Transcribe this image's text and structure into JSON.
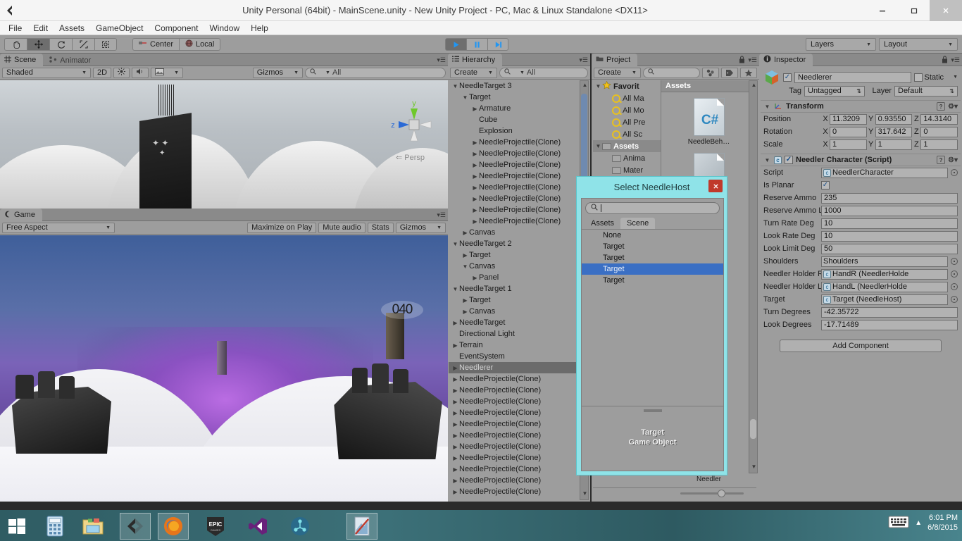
{
  "window": {
    "title": "Unity Personal (64bit) - MainScene.unity - New Unity Project - PC, Mac & Linux Standalone <DX11>",
    "minimize": "—",
    "maximize": "❐",
    "close": "✕"
  },
  "menu": [
    "File",
    "Edit",
    "Assets",
    "GameObject",
    "Component",
    "Window",
    "Help"
  ],
  "toolbar": {
    "tools": [
      "hand-tool",
      "move-tool",
      "rotate-tool",
      "scale-tool",
      "rect-tool"
    ],
    "active_tool_index": 1,
    "pivot_label": "Center",
    "space_label": "Local",
    "play_label": "▶",
    "pause_label": "❙❙",
    "step_label": "▶❙",
    "layers_label": "Layers",
    "layout_label": "Layout"
  },
  "scene_panel": {
    "tabs": [
      {
        "label": "Scene",
        "icon": "grid-icon",
        "active": true
      },
      {
        "label": "Animator",
        "icon": "animator-icon",
        "active": false
      }
    ],
    "draw_mode": "Shaded",
    "mode_2d": "2D",
    "gizmos_label": "Gizmos",
    "search_placeholder": "All",
    "persp_label": "Persp",
    "axis_y": "y",
    "axis_z": "z"
  },
  "game_panel": {
    "tabs": [
      {
        "label": "Game",
        "icon": "game-icon",
        "active": true
      }
    ],
    "aspect": "Free Aspect",
    "maximize_on_play": "Maximize on Play",
    "mute_audio": "Mute audio",
    "stats": "Stats",
    "gizmos": "Gizmos",
    "hud_counter": "040"
  },
  "hierarchy": {
    "tab_label": "Hierarchy",
    "create_label": "Create",
    "search_placeholder": "All",
    "items": [
      {
        "label": "NeedleTarget 3",
        "depth": 0,
        "arrow": "down"
      },
      {
        "label": "Target",
        "depth": 1,
        "arrow": "down"
      },
      {
        "label": "Armature",
        "depth": 2,
        "arrow": "right"
      },
      {
        "label": "Cube",
        "depth": 2,
        "arrow": "none"
      },
      {
        "label": "Explosion",
        "depth": 2,
        "arrow": "none"
      },
      {
        "label": "NeedleProjectile(Clone)",
        "depth": 2,
        "arrow": "right"
      },
      {
        "label": "NeedleProjectile(Clone)",
        "depth": 2,
        "arrow": "right"
      },
      {
        "label": "NeedleProjectile(Clone)",
        "depth": 2,
        "arrow": "right"
      },
      {
        "label": "NeedleProjectile(Clone)",
        "depth": 2,
        "arrow": "right"
      },
      {
        "label": "NeedleProjectile(Clone)",
        "depth": 2,
        "arrow": "right"
      },
      {
        "label": "NeedleProjectile(Clone)",
        "depth": 2,
        "arrow": "right"
      },
      {
        "label": "NeedleProjectile(Clone)",
        "depth": 2,
        "arrow": "right"
      },
      {
        "label": "NeedleProjectile(Clone)",
        "depth": 2,
        "arrow": "right"
      },
      {
        "label": "Canvas",
        "depth": 1,
        "arrow": "right"
      },
      {
        "label": "NeedleTarget 2",
        "depth": 0,
        "arrow": "down"
      },
      {
        "label": "Target",
        "depth": 1,
        "arrow": "right"
      },
      {
        "label": "Canvas",
        "depth": 1,
        "arrow": "down"
      },
      {
        "label": "Panel",
        "depth": 2,
        "arrow": "right"
      },
      {
        "label": "NeedleTarget 1",
        "depth": 0,
        "arrow": "down"
      },
      {
        "label": "Target",
        "depth": 1,
        "arrow": "right"
      },
      {
        "label": "Canvas",
        "depth": 1,
        "arrow": "right"
      },
      {
        "label": "NeedleTarget",
        "depth": 0,
        "arrow": "right"
      },
      {
        "label": "Directional Light",
        "depth": 0,
        "arrow": "none"
      },
      {
        "label": "Terrain",
        "depth": 0,
        "arrow": "right"
      },
      {
        "label": "EventSystem",
        "depth": 0,
        "arrow": "none"
      },
      {
        "label": "Needlerer",
        "depth": 0,
        "arrow": "right",
        "selected": true
      },
      {
        "label": "NeedleProjectile(Clone)",
        "depth": 0,
        "arrow": "right"
      },
      {
        "label": "NeedleProjectile(Clone)",
        "depth": 0,
        "arrow": "right"
      },
      {
        "label": "NeedleProjectile(Clone)",
        "depth": 0,
        "arrow": "right"
      },
      {
        "label": "NeedleProjectile(Clone)",
        "depth": 0,
        "arrow": "right"
      },
      {
        "label": "NeedleProjectile(Clone)",
        "depth": 0,
        "arrow": "right"
      },
      {
        "label": "NeedleProjectile(Clone)",
        "depth": 0,
        "arrow": "right"
      },
      {
        "label": "NeedleProjectile(Clone)",
        "depth": 0,
        "arrow": "right"
      },
      {
        "label": "NeedleProjectile(Clone)",
        "depth": 0,
        "arrow": "right"
      },
      {
        "label": "NeedleProjectile(Clone)",
        "depth": 0,
        "arrow": "right"
      },
      {
        "label": "NeedleProjectile(Clone)",
        "depth": 0,
        "arrow": "right"
      },
      {
        "label": "NeedleProjectile(Clone)",
        "depth": 0,
        "arrow": "right"
      }
    ]
  },
  "project": {
    "tab_label": "Project",
    "create_label": "Create",
    "search_placeholder": "",
    "tree": [
      {
        "label": "Favorit",
        "icon": "star-icon",
        "depth": 0,
        "arrow": "down",
        "bold": true
      },
      {
        "label": "All Ma",
        "icon": "search-icon",
        "depth": 1,
        "arrow": "none"
      },
      {
        "label": "All Mo",
        "icon": "search-icon",
        "depth": 1,
        "arrow": "none"
      },
      {
        "label": "All Pre",
        "icon": "search-icon",
        "depth": 1,
        "arrow": "none"
      },
      {
        "label": "All Sc",
        "icon": "search-icon",
        "depth": 1,
        "arrow": "none"
      },
      {
        "label": "Assets",
        "icon": "folder-icon",
        "depth": 0,
        "arrow": "down",
        "selected": true
      },
      {
        "label": "Anima",
        "icon": "folder-icon",
        "depth": 1,
        "arrow": "none"
      },
      {
        "label": "Mater",
        "icon": "folder-icon",
        "depth": 1,
        "arrow": "none"
      }
    ],
    "content_header": "Assets",
    "assets": [
      {
        "label": "NeedleBeh…",
        "icon": "csharp-script-icon"
      },
      {
        "label": "Needler",
        "icon": "prefab-icon"
      }
    ]
  },
  "inspector": {
    "tab_label": "Inspector",
    "object_name": "Needlerer",
    "enabled": true,
    "static_label": "Static",
    "tag_label": "Tag",
    "tag_value": "Untagged",
    "layer_label": "Layer",
    "layer_value": "Default",
    "transform": {
      "title": "Transform",
      "rows": [
        {
          "label": "Position",
          "x": "11.3209",
          "y": "0.93550",
          "z": "14.3140"
        },
        {
          "label": "Rotation",
          "x": "0",
          "y": "317.642",
          "z": "0"
        },
        {
          "label": "Scale",
          "x": "1",
          "y": "1",
          "z": "1"
        }
      ],
      "axes": [
        "X",
        "Y",
        "Z"
      ]
    },
    "script_component": {
      "title": "Needler Character (Script)",
      "enabled": true,
      "fields": [
        {
          "label": "Script",
          "value": "NeedlerCharacter",
          "type": "object",
          "icon": "script-icon"
        },
        {
          "label": "Is Planar",
          "value": "",
          "type": "checkbox",
          "checked": true
        },
        {
          "label": "Reserve Ammo",
          "value": "235",
          "type": "text"
        },
        {
          "label": "Reserve Ammo Limit",
          "value": "1000",
          "type": "text"
        },
        {
          "label": "Turn Rate Deg",
          "value": "10",
          "type": "text"
        },
        {
          "label": "Look Rate Deg",
          "value": "10",
          "type": "text"
        },
        {
          "label": "Look Limit Deg",
          "value": "50",
          "type": "text"
        },
        {
          "label": "Shoulders",
          "value": "Shoulders",
          "type": "object"
        },
        {
          "label": "Needler Holder R",
          "value": "HandR (NeedlerHolde",
          "type": "object",
          "icon": "script-icon"
        },
        {
          "label": "Needler Holder L",
          "value": "HandL (NeedlerHolde",
          "type": "object",
          "icon": "script-icon"
        },
        {
          "label": "Target",
          "value": "Target (NeedleHost)",
          "type": "object",
          "icon": "script-icon"
        },
        {
          "label": "Turn Degrees",
          "value": "-42.35722",
          "type": "text"
        },
        {
          "label": "Look Degrees",
          "value": "-17.71489",
          "type": "text"
        }
      ]
    },
    "add_component_label": "Add Component"
  },
  "dialog": {
    "title": "Select NeedleHost",
    "close_label": "✕",
    "search_value": "",
    "tabs": [
      {
        "label": "Assets",
        "active": false
      },
      {
        "label": "Scene",
        "active": true
      }
    ],
    "rows": [
      {
        "label": "None",
        "selected": false
      },
      {
        "label": "Target",
        "selected": false
      },
      {
        "label": "Target",
        "selected": false
      },
      {
        "label": "Target",
        "selected": true
      },
      {
        "label": "Target",
        "selected": false
      }
    ],
    "preview_line1": "Target",
    "preview_line2": "Game Object"
  },
  "taskbar": {
    "items": [
      {
        "name": "start-button",
        "icon": "windows-logo"
      },
      {
        "name": "calculator",
        "icon": "calculator-icon"
      },
      {
        "name": "file-explorer",
        "icon": "folder-icon"
      },
      {
        "name": "unity",
        "icon": "unity-icon",
        "active": true
      },
      {
        "name": "firefox",
        "icon": "firefox-icon",
        "active": true
      },
      {
        "name": "epic-games",
        "icon": "epic-icon"
      },
      {
        "name": "visual-studio",
        "icon": "visual-studio-icon"
      },
      {
        "name": "sourcetree",
        "icon": "sourcetree-icon"
      },
      {
        "name": "paint",
        "icon": "paint-icon",
        "active": true
      }
    ],
    "time": "6:01 PM",
    "date": "6/8/2015"
  },
  "colors": {
    "unity_gray": "#9d9d9d",
    "dialog_accent": "#8fe3e8",
    "selection_blue": "#3a6fc4",
    "play_blue": "#2196f3"
  }
}
